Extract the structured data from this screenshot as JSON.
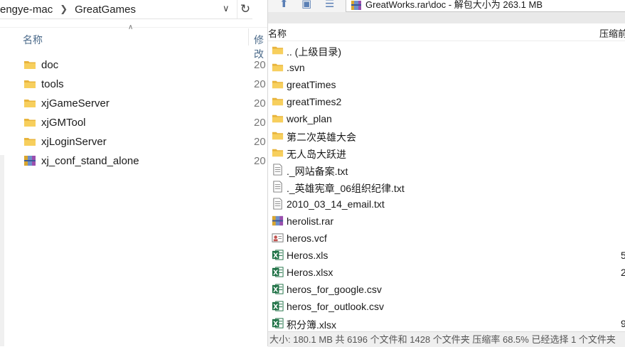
{
  "explorer": {
    "address": {
      "segment1": "engye-mac",
      "segment2": "GreatGames"
    },
    "columns": {
      "name": "名称",
      "modified": "修改"
    },
    "items": [
      {
        "name": "doc",
        "date": "20",
        "icon": "folder-icon"
      },
      {
        "name": "tools",
        "date": "20",
        "icon": "folder-icon"
      },
      {
        "name": "xjGameServer",
        "date": "20",
        "icon": "folder-icon"
      },
      {
        "name": "xjGMTool",
        "date": "20",
        "icon": "folder-icon"
      },
      {
        "name": "xjLoginServer",
        "date": "20",
        "icon": "folder-icon"
      },
      {
        "name": "xj_conf_stand_alone",
        "date": "20",
        "icon": "rar-archive-icon"
      }
    ]
  },
  "rar": {
    "path": "GreatWorks.rar\\doc - 解包大小为 263.1 MB",
    "columns": {
      "name": "名称",
      "packed": "压缩前"
    },
    "items": [
      {
        "name": ".. (上级目录)",
        "size": "",
        "icon": "folder-icon"
      },
      {
        "name": ".svn",
        "size": "",
        "icon": "folder-icon"
      },
      {
        "name": "greatTimes",
        "size": "",
        "icon": "folder-icon"
      },
      {
        "name": "greatTimes2",
        "size": "",
        "icon": "folder-icon"
      },
      {
        "name": "work_plan",
        "size": "",
        "icon": "folder-icon"
      },
      {
        "name": "第二次英雄大会",
        "size": "",
        "icon": "folder-icon"
      },
      {
        "name": "无人岛大跃进",
        "size": "",
        "icon": "folder-icon"
      },
      {
        "name": "._网站备案.txt",
        "size": "",
        "icon": "text-file-icon"
      },
      {
        "name": "._英雄宪章_06组织纪律.txt",
        "size": "",
        "icon": "text-file-icon"
      },
      {
        "name": "2010_03_14_email.txt",
        "size": "",
        "icon": "text-file-icon"
      },
      {
        "name": "herolist.rar",
        "size": "",
        "icon": "rar-archive-icon"
      },
      {
        "name": "heros.vcf",
        "size": "",
        "icon": "contact-card-icon"
      },
      {
        "name": "Heros.xls",
        "size": "5",
        "icon": "excel-icon"
      },
      {
        "name": "Heros.xlsx",
        "size": "2",
        "icon": "excel-icon"
      },
      {
        "name": "heros_for_google.csv",
        "size": "",
        "icon": "excel-icon"
      },
      {
        "name": "heros_for_outlook.csv",
        "size": "",
        "icon": "excel-icon"
      },
      {
        "name": "积分簿.xlsx",
        "size": "9",
        "icon": "excel-icon"
      }
    ],
    "status": "大小: 180.1 MB 共 6196 个文件和 1428 个文件夹 压缩率 68.5% 已经选择 1 个文件夹"
  }
}
